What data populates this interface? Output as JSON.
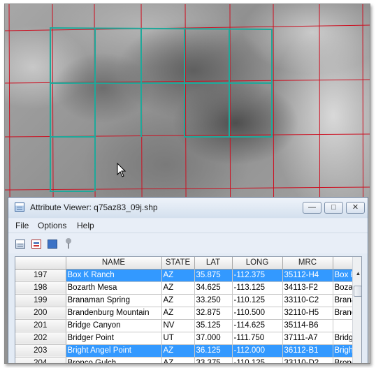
{
  "window": {
    "title": "Attribute Viewer: q75az83_09j.shp",
    "min_glyph": "—",
    "max_glyph": "□",
    "close_glyph": "✕"
  },
  "menu": {
    "file": "File",
    "options": "Options",
    "help": "Help"
  },
  "toolbar": {
    "icons": [
      "table-icon",
      "filter-icon",
      "select-icon",
      "pin-icon"
    ]
  },
  "map": {
    "grid_color": "#cc1122",
    "tile_color": "#1fa89a",
    "cursor": "arrow-cursor-icon"
  },
  "table": {
    "columns": [
      "",
      "NAME",
      "STATE",
      "LAT",
      "LONG",
      "MRC",
      ""
    ],
    "rows": [
      {
        "id": "197",
        "name": "Box K Ranch",
        "state": "AZ",
        "lat": "35.875",
        "long": "-112.375",
        "mrc": "35112-H4",
        "ext": "Box K",
        "selected": true
      },
      {
        "id": "198",
        "name": "Bozarth Mesa",
        "state": "AZ",
        "lat": "34.625",
        "long": "-113.125",
        "mrc": "34113-F2",
        "ext": "Boza",
        "selected": false
      },
      {
        "id": "199",
        "name": "Branaman Spring",
        "state": "AZ",
        "lat": "33.250",
        "long": "-110.125",
        "mrc": "33110-C2",
        "ext": "Brana",
        "selected": false
      },
      {
        "id": "200",
        "name": "Brandenburg Mountain",
        "state": "AZ",
        "lat": "32.875",
        "long": "-110.500",
        "mrc": "32110-H5",
        "ext": "Brand",
        "selected": false
      },
      {
        "id": "201",
        "name": "Bridge Canyon",
        "state": "NV",
        "lat": "35.125",
        "long": "-114.625",
        "mrc": "35114-B6",
        "ext": "",
        "selected": false
      },
      {
        "id": "202",
        "name": "Bridger Point",
        "state": "UT",
        "lat": "37.000",
        "long": "-111.750",
        "mrc": "37111-A7",
        "ext": "Bridg",
        "selected": false
      },
      {
        "id": "203",
        "name": "Bright Angel Point",
        "state": "AZ",
        "lat": "36.125",
        "long": "-112.000",
        "mrc": "36112-B1",
        "ext": "Brigh",
        "selected": true
      },
      {
        "id": "204",
        "name": "Bronco Gulch",
        "state": "AZ",
        "lat": "33.375",
        "long": "-110.125",
        "mrc": "33110-D2",
        "ext": "Bronc",
        "selected": false
      }
    ]
  },
  "scrollbar": {
    "up_glyph": "▲"
  }
}
